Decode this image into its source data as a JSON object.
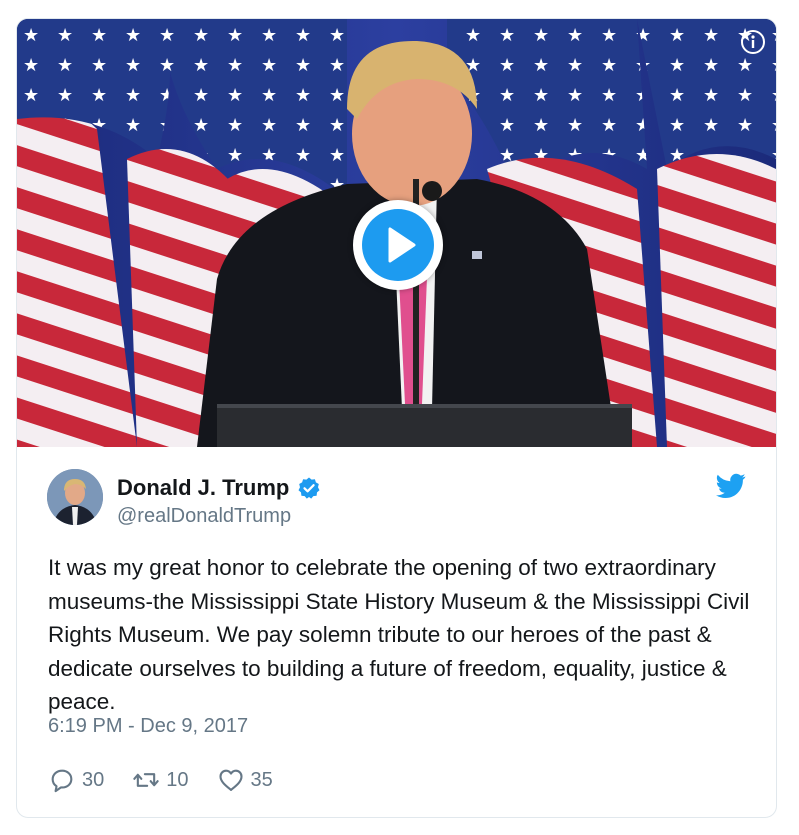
{
  "colors": {
    "accent": "#1d9bf0",
    "text_primary": "#14171a",
    "text_secondary": "#657786",
    "border": "#e1e8ed"
  },
  "media": {
    "info_icon": "info-icon",
    "play_icon": "play-icon"
  },
  "author": {
    "name": "Donald J. Trump",
    "handle": "@realDonaldTrump",
    "verified_icon": "verified-badge-icon",
    "platform_icon": "twitter-bird-icon"
  },
  "tweet": {
    "text": "It was my great honor to celebrate the opening of two extraordinary museums-the Mississippi State History Museum & the Mississippi Civil Rights Museum. We pay solemn tribute to our heroes of the past & dedicate ourselves to building a future of freedom, equality, justice & peace.",
    "timestamp": "6:19 PM - Dec 9, 2017"
  },
  "actions": {
    "replies": {
      "icon": "reply-icon",
      "count": "30"
    },
    "retweets": {
      "icon": "retweet-icon",
      "count": "10"
    },
    "likes": {
      "icon": "heart-icon",
      "count": "35"
    }
  }
}
